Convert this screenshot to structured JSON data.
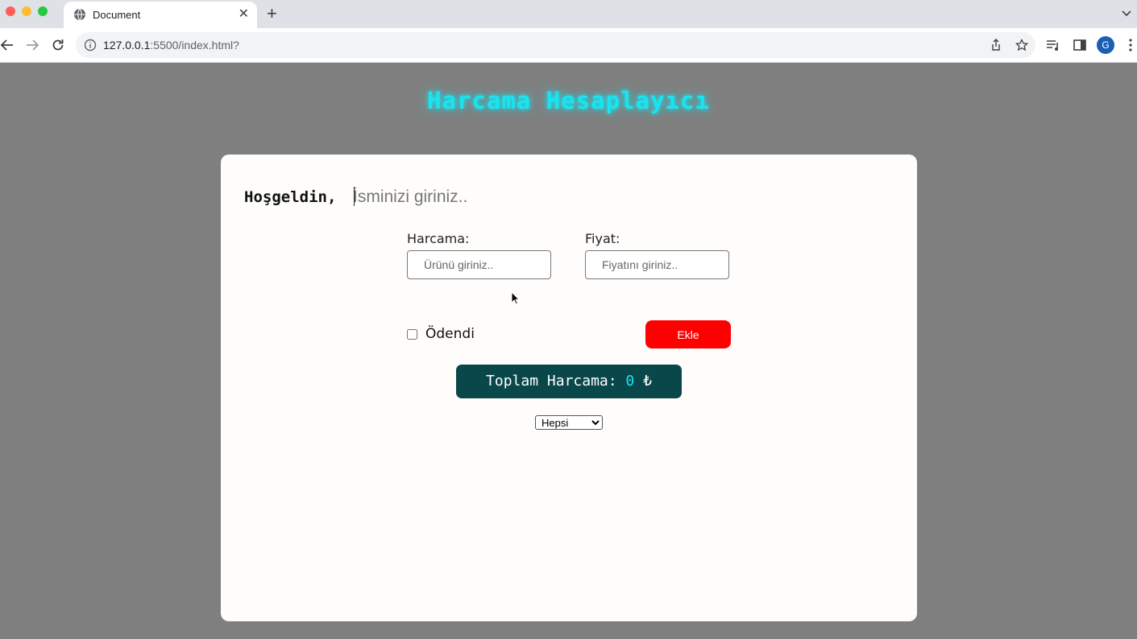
{
  "browser": {
    "tab_title": "Document",
    "tab_close": "✕",
    "new_tab": "+",
    "url_host": "127.0.0.1",
    "url_rest": ":5500/index.html?",
    "profile_initial": "G"
  },
  "header": {
    "title": "Harcama Hesaplayıcı"
  },
  "greeting": {
    "label": "Hoşgeldin,",
    "name_placeholder": "İsminizi giriniz.."
  },
  "form": {
    "expense_label": "Harcama:",
    "expense_placeholder": "Ürünü giriniz..",
    "price_label": "Fiyat:",
    "price_placeholder": "Fiyatını giriniz..",
    "paid_label": "Ödendi",
    "add_button": "Ekle"
  },
  "total": {
    "label": "Toplam Harcama: ",
    "value": "0",
    "currency": " ₺"
  },
  "filter": {
    "selected": "Hepsi",
    "options": [
      "Hepsi"
    ]
  },
  "colors": {
    "title_glow": "#19e4f0",
    "add_button": "#ff0000",
    "total_bg": "#09474a",
    "page_bg": "#7f7f7f"
  }
}
